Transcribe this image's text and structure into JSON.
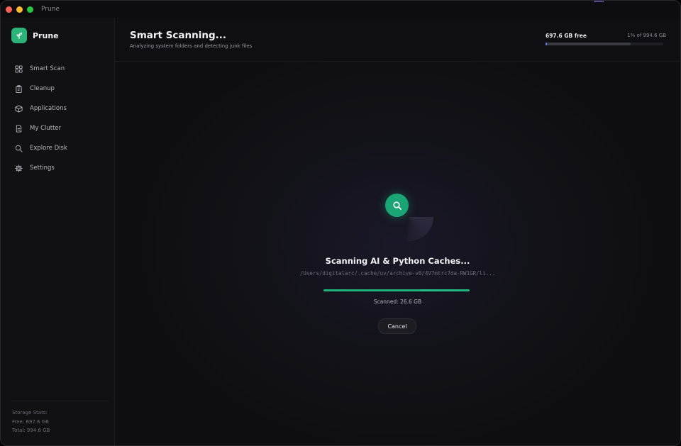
{
  "window": {
    "title": "Prune"
  },
  "sidebar": {
    "brand": "Prune",
    "items": [
      {
        "label": "Smart Scan",
        "icon": "grid-icon"
      },
      {
        "label": "Cleanup",
        "icon": "clipboard-icon"
      },
      {
        "label": "Applications",
        "icon": "box-icon"
      },
      {
        "label": "My Clutter",
        "icon": "document-icon"
      },
      {
        "label": "Explore Disk",
        "icon": "search-icon"
      },
      {
        "label": "Settings",
        "icon": "gear-icon"
      }
    ],
    "storage": {
      "heading": "Storage Stats:",
      "free": "Free: 697.6 GB",
      "total": "Total: 994.6 GB"
    }
  },
  "header": {
    "title": "Smart Scanning...",
    "subtitle": "Analyzing system folders and detecting junk files",
    "disk_free": "697.6 GB free",
    "disk_used": "1% of 994.6 GB",
    "disk_used_fraction": 0.01
  },
  "scan": {
    "title": "Scanning AI & Python Caches...",
    "path": "/Users/digitalarc/.cache/uv/archive-v0/4V7mtrc7da-RW1GR/li...",
    "progress_fraction": 1.0,
    "scanned": "Scanned: 26.6 GB",
    "cancel": "Cancel"
  },
  "colors": {
    "accent": "#1aa574",
    "disk_fill": "#6a7cff",
    "background": "#0d0d10"
  }
}
